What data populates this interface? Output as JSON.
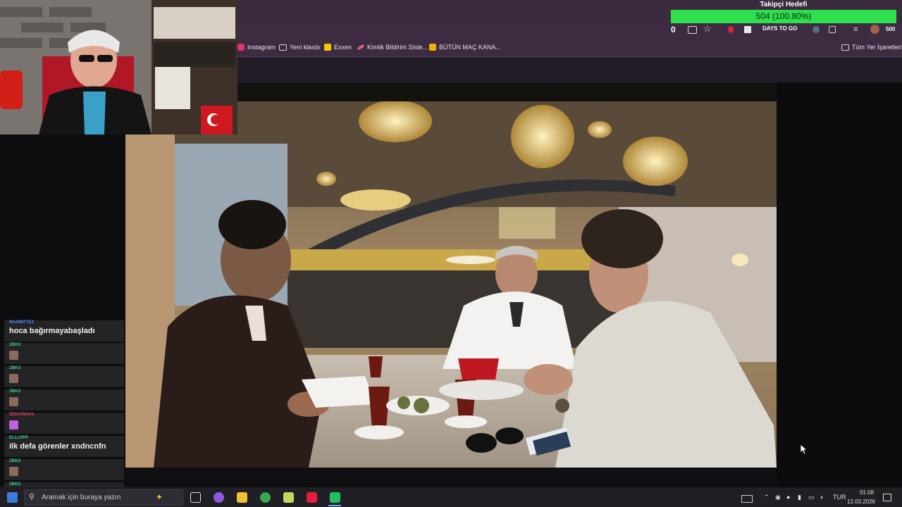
{
  "goal": {
    "title": "Takipçi Hedefi",
    "progress_text": "504 (100.80%)",
    "progress": 1.0,
    "fill_color": "#2de04c"
  },
  "toolbar": {
    "counter": "0",
    "extension_label": "DAYS TO GO",
    "viewer_count": "500"
  },
  "bookmarks": {
    "items": [
      {
        "label": "Instagram",
        "icon": "instagram-icon"
      },
      {
        "label": "Yeni klasör",
        "icon": "folder-icon"
      },
      {
        "label": "Exxen",
        "icon": "exxen-icon"
      },
      {
        "label": "Kimlik Bildirim Siste...",
        "icon": "kimlik-icon"
      },
      {
        "label": "BÜTÜN MAÇ KANA...",
        "icon": "jp-icon"
      }
    ],
    "all_bookmarks": "Tüm Yer İşaretleri"
  },
  "chat": {
    "messages": [
      {
        "user": "MAXIMTTEZ",
        "text": "hoca bağırmayabaşladı",
        "user_color": "#4f8cff"
      },
      {
        "user": "ZBKS",
        "text": "",
        "emote": true,
        "user_color": "#3ccf8a"
      },
      {
        "user": "ZBKS",
        "text": "",
        "emote": true,
        "user_color": "#3ccf8a"
      },
      {
        "user": "ZBKS",
        "text": "",
        "emote": true,
        "user_color": "#3ccf8a"
      },
      {
        "user": "ZEKAYBAYA",
        "text": "",
        "emote": true,
        "user_color": "#e0426a"
      },
      {
        "user": "ELLLPPP",
        "text": "ilk defa görenler xndncnfn",
        "user_color": "#3ccf8a"
      },
      {
        "user": "ZBKS",
        "text": "",
        "emote": true,
        "user_color": "#3ccf8a"
      },
      {
        "user": "ZBKS",
        "text": "",
        "emote": true,
        "user_color": "#3ccf8a"
      }
    ]
  },
  "taskbar": {
    "search_placeholder": "Aramak için buraya yazın",
    "language": "TUR",
    "time": "01:08",
    "date": "12.03.2026"
  }
}
